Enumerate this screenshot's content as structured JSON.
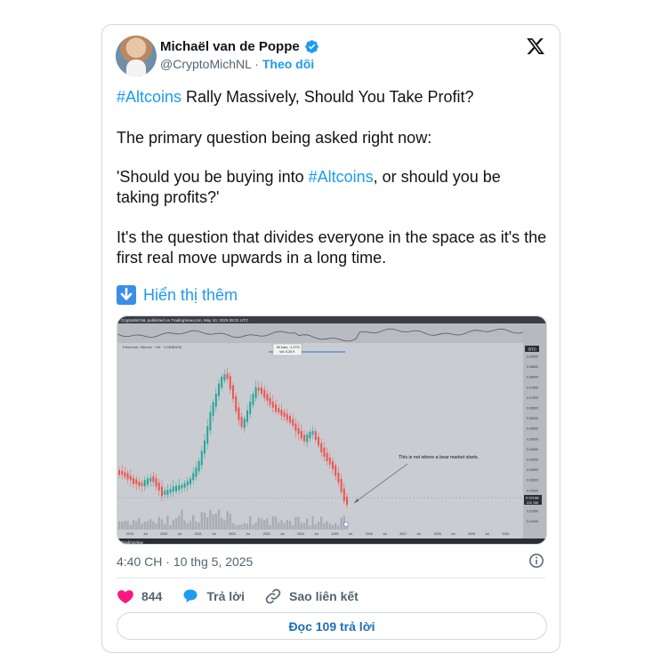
{
  "author": {
    "name": "Michaël van de Poppe",
    "handle": "@CryptoMichNL",
    "separator": "·",
    "follow_label": "Theo dõi"
  },
  "tweet": {
    "paragraph1": {
      "hashtag": "#Altcoins",
      "rest": " Rally Massively, Should You Take Profit?"
    },
    "paragraph2": "The primary question being asked right now:",
    "paragraph3": {
      "before": "'Should you be buying into ",
      "hashtag": "#Altcoins",
      "after": ", or should you be taking profits?'"
    },
    "paragraph4": "It's the question that divides everyone in the space as it's the first real move upwards in a long time.",
    "show_more": "Hiển thị thêm"
  },
  "media": {
    "header_text": "CryptoMichNL published on TradingView.com, May 10, 2025 09:21 UTC",
    "pair_text": "Ethereum / Bitcoin · 1W · COINBASE",
    "annotation": "This is not where a bear market starts.",
    "measure_line1": "-90 bars, -1.27%",
    "measure_line2": "Vol: 6.26 K",
    "badge_currency": "BTC",
    "price_label": "0.02198",
    "price_label2": "212 15h",
    "watermark": "TradingView",
    "y_ticks": [
      "0.09000",
      "0.08500",
      "0.08000",
      "0.07500",
      "0.07000",
      "0.06500",
      "0.06000",
      "0.05500",
      "0.05000",
      "0.04500",
      "0.04000",
      "0.03500",
      "0.03000",
      "0.02500",
      "0.02000",
      "0.01500",
      "0.01000"
    ],
    "x_ticks": [
      "2019",
      "Jul",
      "2020",
      "Jul",
      "2021",
      "Jul",
      "2022",
      "Jul",
      "2023",
      "Jul",
      "2024",
      "Jul",
      "2025",
      "Jul",
      "2026",
      "Jul",
      "2027",
      "Jul",
      "2028",
      "Jul",
      "2029",
      "Jul",
      "2030"
    ],
    "accent_up": "#26a69a",
    "accent_down": "#ef5350"
  },
  "meta": {
    "time": "4:40 CH",
    "date": "10 thg 5, 2025",
    "dot": "·"
  },
  "actions": {
    "likes": "844",
    "reply_label": "Trả lời",
    "copy_link_label": "Sao liên kết",
    "read_replies": "Đọc 109 trả lời"
  }
}
